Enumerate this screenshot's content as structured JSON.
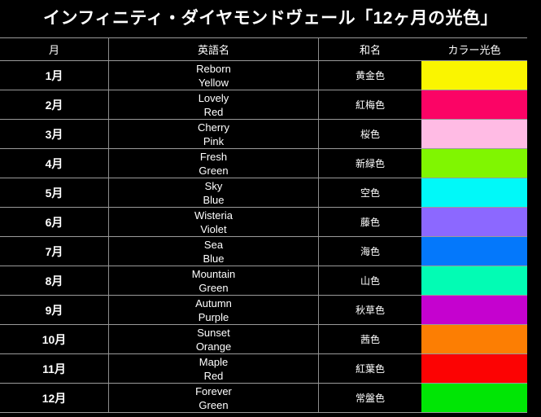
{
  "title": "インフィニティ・ダイヤモンドヴェール「12ヶ月の光色」",
  "table": {
    "headers": {
      "month": "月",
      "english_name": "英語名",
      "japanese_name": "和名",
      "color_light": "カラー光色"
    },
    "rows": [
      {
        "month": "1月",
        "en_line1": "Reborn",
        "en_line2": "Yellow",
        "ja": "黄金色",
        "color": "#FAF500"
      },
      {
        "month": "2月",
        "en_line1": "Lovely",
        "en_line2": "Red",
        "ja": "紅梅色",
        "color": "#FB0465"
      },
      {
        "month": "3月",
        "en_line1": "Cherry",
        "en_line2": "Pink",
        "ja": "桜色",
        "color": "#FFBBE4"
      },
      {
        "month": "4月",
        "en_line1": "Fresh",
        "en_line2": "Green",
        "ja": "新緑色",
        "color": "#80F601"
      },
      {
        "month": "5月",
        "en_line1": "Sky",
        "en_line2": "Blue",
        "ja": "空色",
        "color": "#00F9F9"
      },
      {
        "month": "6月",
        "en_line1": "Wisteria",
        "en_line2": "Violet",
        "ja": "藤色",
        "color": "#8C68FF"
      },
      {
        "month": "7月",
        "en_line1": "Sea",
        "en_line2": "Blue",
        "ja": "海色",
        "color": "#0478FB"
      },
      {
        "month": "8月",
        "en_line1": "Mountain",
        "en_line2": "Green",
        "ja": "山色",
        "color": "#02FCB4"
      },
      {
        "month": "9月",
        "en_line1": "Autumn",
        "en_line2": "Purple",
        "ja": "秋草色",
        "color": "#C502CF"
      },
      {
        "month": "10月",
        "en_line1": "Sunset",
        "en_line2": "Orange",
        "ja": "茜色",
        "color": "#FC7E03"
      },
      {
        "month": "11月",
        "en_line1": "Maple",
        "en_line2": "Red",
        "ja": "紅葉色",
        "color": "#FC0303"
      },
      {
        "month": "12月",
        "en_line1": "Forever",
        "en_line2": "Green",
        "ja": "常盤色",
        "color": "#00E605"
      }
    ]
  }
}
